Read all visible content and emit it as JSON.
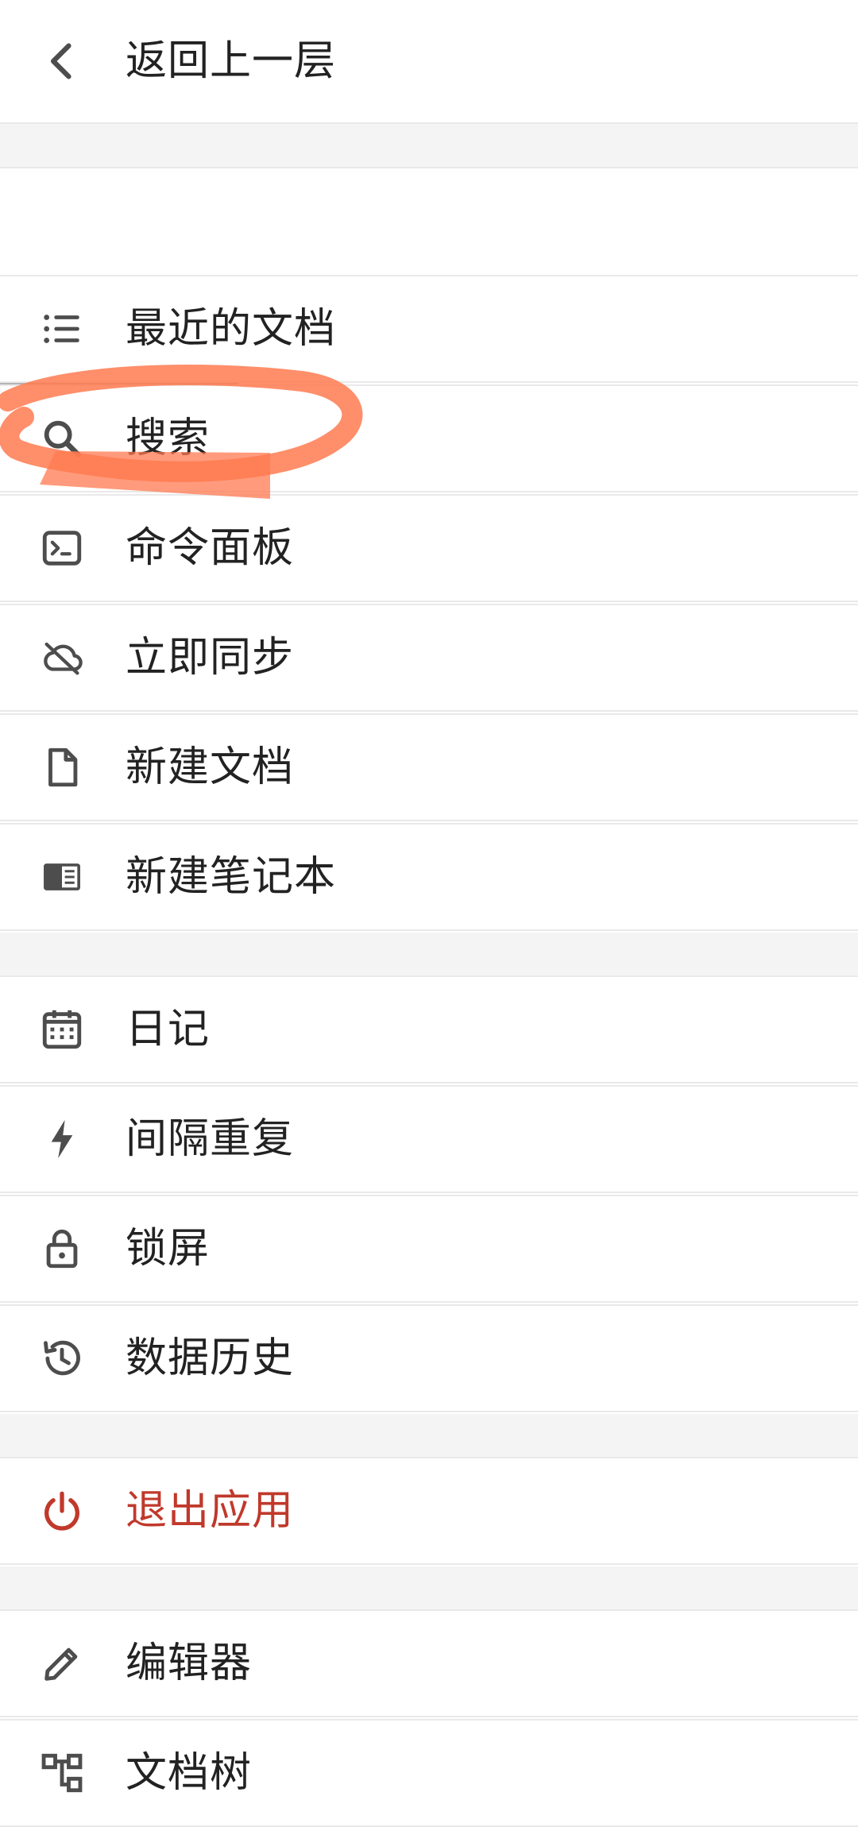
{
  "header": {
    "back_label": "返回上一层",
    "icon": "chevron-left-icon"
  },
  "main_menu": {
    "items": [
      {
        "label": "最近的文档",
        "icon": "list-icon"
      },
      {
        "label": "搜索",
        "icon": "search-icon"
      },
      {
        "label": "命令面板",
        "icon": "terminal-icon"
      },
      {
        "label": "立即同步",
        "icon": "cloud-off-icon"
      },
      {
        "label": "新建文档",
        "icon": "file-icon"
      },
      {
        "label": "新建笔记本",
        "icon": "notebook-icon"
      }
    ]
  },
  "tools_menu": {
    "items": [
      {
        "label": "日记",
        "icon": "calendar-icon"
      },
      {
        "label": "间隔重复",
        "icon": "lightning-icon"
      },
      {
        "label": "锁屏",
        "icon": "lock-icon"
      },
      {
        "label": "数据历史",
        "icon": "history-icon"
      }
    ]
  },
  "exit_menu": {
    "label": "退出应用",
    "icon": "power-icon",
    "color": "#c0392b"
  },
  "settings_menu": {
    "items": [
      {
        "label": "编辑器",
        "icon": "pencil-icon"
      },
      {
        "label": "文档树",
        "icon": "tree-icon"
      }
    ]
  },
  "colors": {
    "text": "#222222",
    "icon": "#4d4d4d",
    "danger": "#c0392b",
    "separator": "#f4f4f4",
    "divider": "#e9e9e9",
    "annotation": "#ff7a50",
    "redaction": "#b3b3b3"
  }
}
